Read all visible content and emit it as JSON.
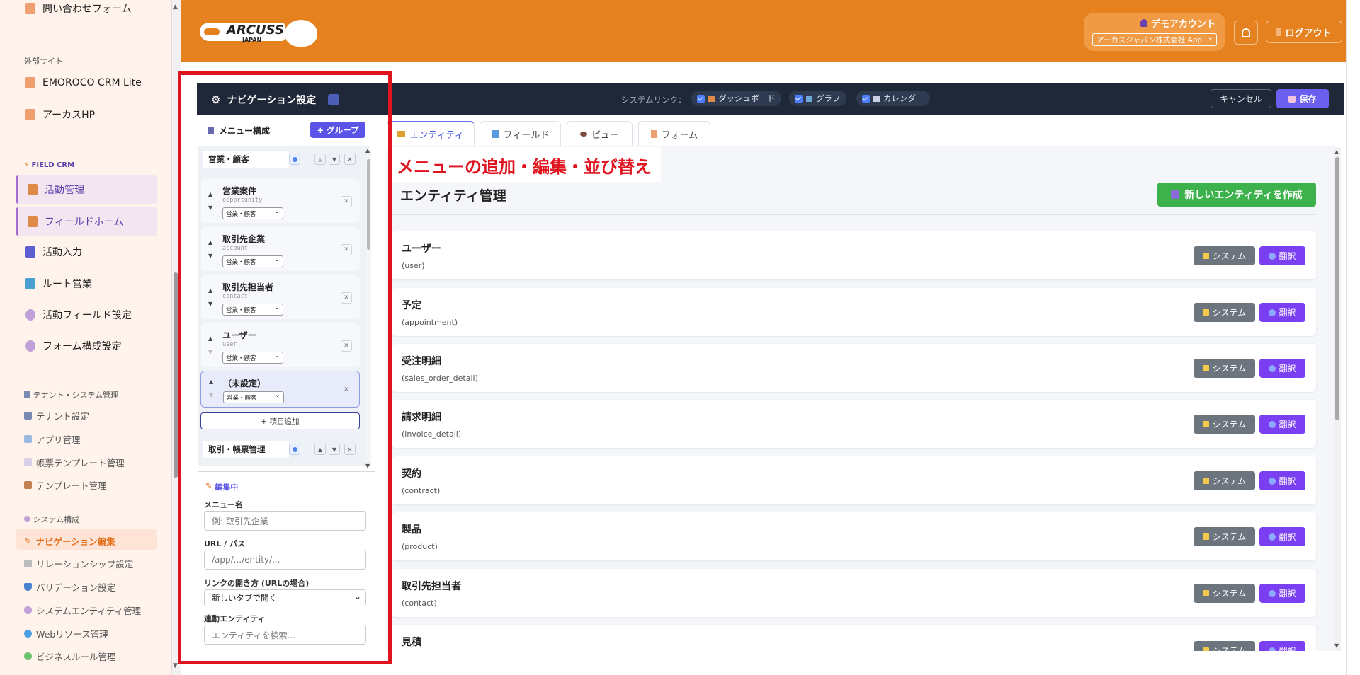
{
  "sidebar": {
    "top_item": "問い合わせフォーム",
    "external_header": "外部サイト",
    "external": [
      "EMOROCO CRM Lite",
      "アーカスHP"
    ],
    "field_crm_header": "FIELD CRM",
    "field_crm": [
      "活動管理",
      "フィールドホーム",
      "活動入力",
      "ルート営業",
      "活動フィールド設定",
      "フォーム構成設定"
    ],
    "tenant_header": "テナント・システム管理",
    "tenant": [
      "テナント設定",
      "アプリ管理",
      "帳票テンプレート管理",
      "テンプレート管理"
    ],
    "system_header": "システム構成",
    "system": [
      "ナビゲーション編集",
      "リレーションシップ設定",
      "バリデーション設定",
      "システムエンティティ管理",
      "Webリソース管理",
      "ビジネスルール管理"
    ]
  },
  "header": {
    "logo_text": "ARCUSS",
    "logo_sub": "JAPAN",
    "account_name": "デモアカウント",
    "app_select": "アーカスジャパン株式会社 App",
    "logout": "ログアウト"
  },
  "navbar": {
    "title": "ナビゲーション設定",
    "system_link_label": "システムリンク：",
    "links": [
      "ダッシュボード",
      "グラフ",
      "カレンダー"
    ],
    "cancel": "キャンセル",
    "save": "保存"
  },
  "menu": {
    "title": "メニュー構成",
    "add_group": "+ グループ",
    "group1": "営業・顧客",
    "items": [
      {
        "name": "営業案件",
        "id": "opportunity",
        "group": "営業・顧客"
      },
      {
        "name": "取引先企業",
        "id": "account",
        "group": "営業・顧客"
      },
      {
        "name": "取引先担当者",
        "id": "contact",
        "group": "営業・顧客"
      },
      {
        "name": "ユーザー",
        "id": "user",
        "group": "営業・顧客"
      },
      {
        "name": "（未設定）",
        "id": "",
        "group": "営業・顧客"
      }
    ],
    "add_item": "+ 項目追加",
    "group2": "取引・帳票管理"
  },
  "editor": {
    "status": "編集中",
    "menu_name_label": "メニュー名",
    "menu_name_placeholder": "例: 取引先企業",
    "url_label": "URL / パス",
    "url_placeholder": "/app/.../entity/...",
    "open_label": "リンクの開き方 (URLの場合)",
    "open_value": "新しいタブで開く",
    "entity_label": "連動エンティティ",
    "entity_placeholder": "エンティティを検索..."
  },
  "tabs": [
    "エンティティ",
    "フィールド",
    "ビュー",
    "フォーム"
  ],
  "annotation": "メニューの追加・編集・並び替え",
  "entity_page": {
    "title": "エンティティ管理",
    "create_button": "新しいエンティティを作成",
    "system_label": "システム",
    "translate_label": "翻訳",
    "entities": [
      {
        "name": "ユーザー",
        "id": "(user)"
      },
      {
        "name": "予定",
        "id": "(appointment)"
      },
      {
        "name": "受注明細",
        "id": "(sales_order_detail)"
      },
      {
        "name": "請求明細",
        "id": "(invoice_detail)"
      },
      {
        "name": "契約",
        "id": "(contract)"
      },
      {
        "name": "製品",
        "id": "(product)"
      },
      {
        "name": "取引先担当者",
        "id": "(contact)"
      },
      {
        "name": "見積",
        "id": ""
      }
    ]
  },
  "colors": {
    "header": "#e5811e",
    "navbar": "#1f2838",
    "accent": "#6b5ff0",
    "highlight_box": "#e0141e"
  }
}
